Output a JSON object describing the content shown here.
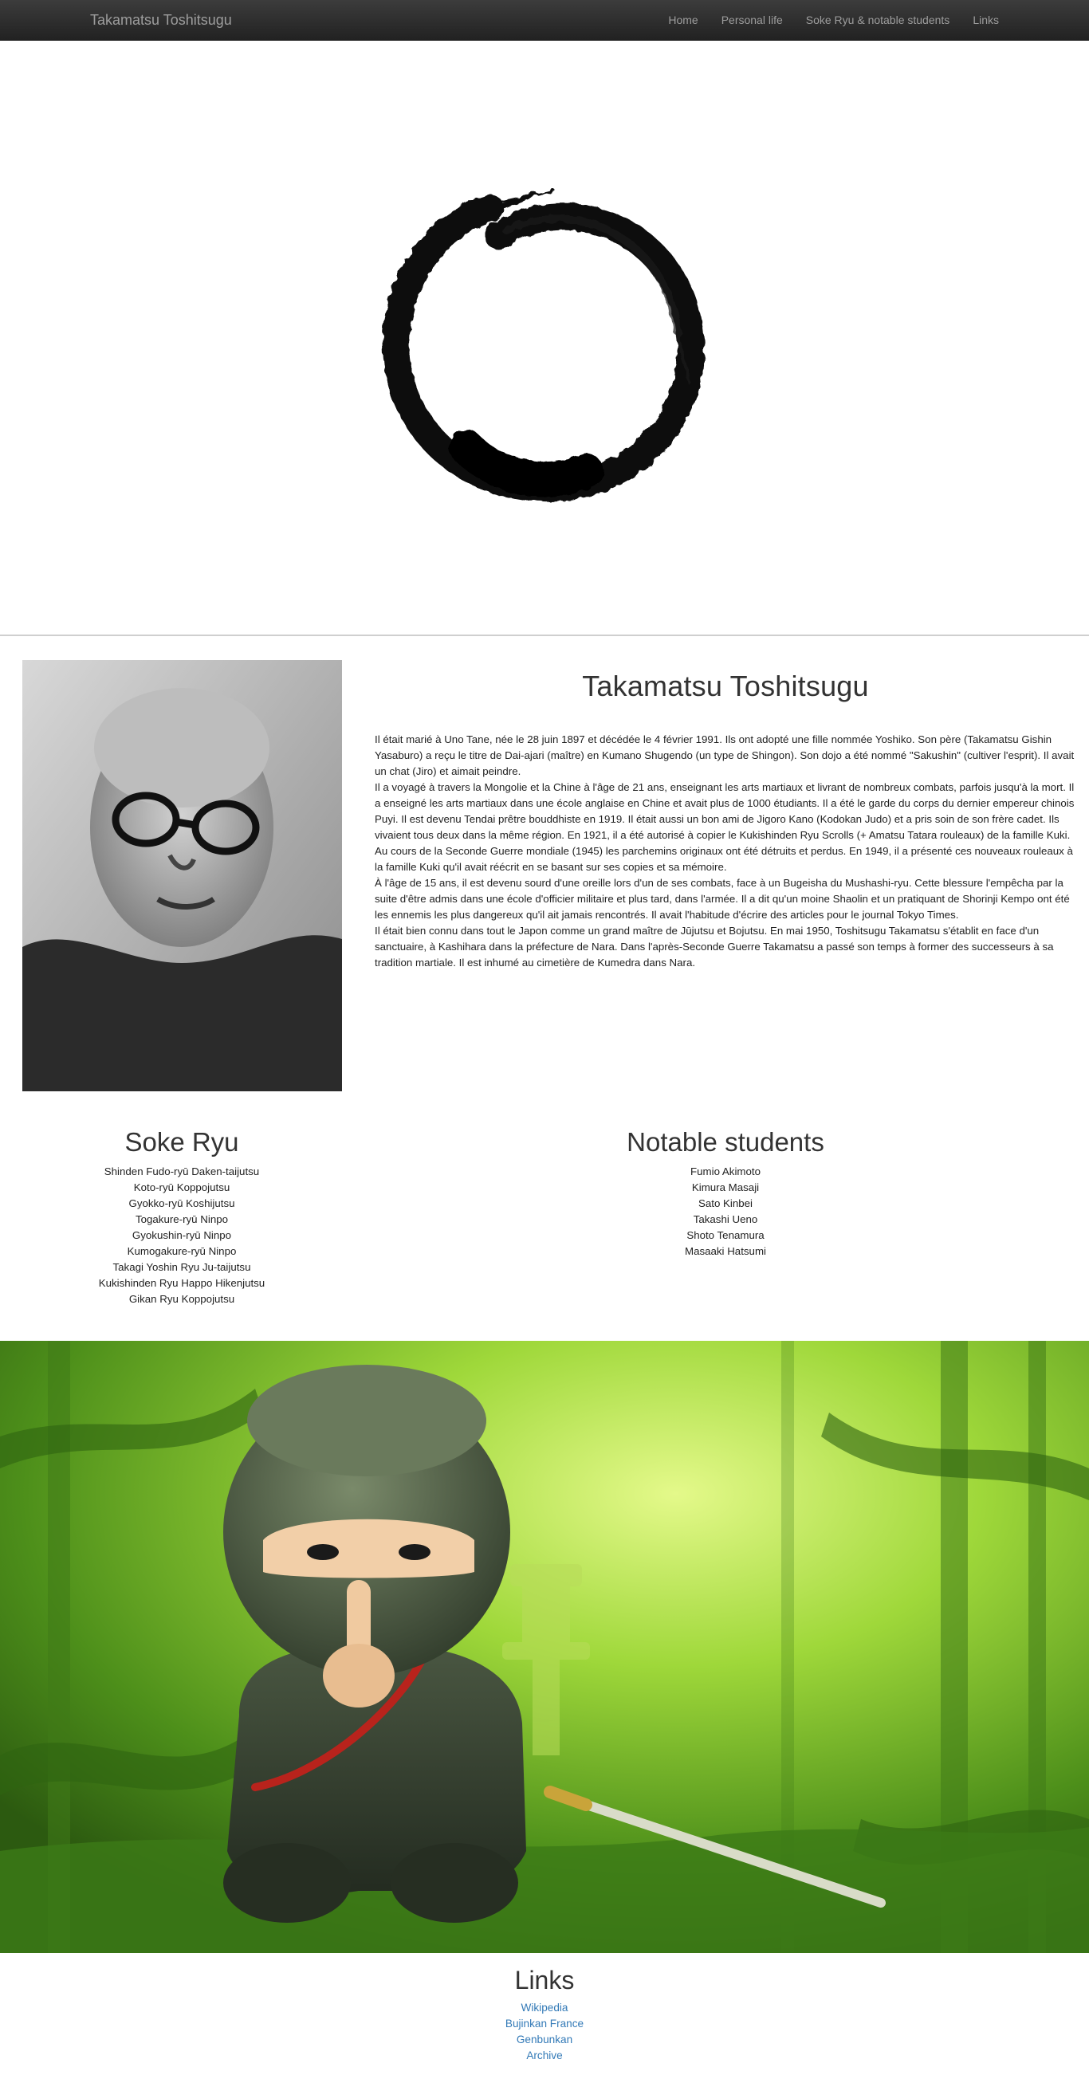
{
  "navbar": {
    "brand": "Takamatsu Toshitsugu",
    "links": [
      "Home",
      "Personal life",
      "Soke Ryu & notable students",
      "Links"
    ]
  },
  "hero": {
    "image": "enso-circle"
  },
  "bio": {
    "portrait": "portrait-photo",
    "title": "Takamatsu Toshitsugu",
    "paragraphs": [
      "Il était marié à Uno Tane, née le 28 juin 1897 et décédée le 4 février 1991. Ils ont adopté une fille nommée Yoshiko. Son père (Takamatsu Gishin Yasaburo) a reçu le titre de Dai-ajari (maître) en Kumano Shugendo (un type de Shingon). Son dojo a été nommé \"Sakushin\" (cultiver l'esprit). Il avait un chat (Jiro) et aimait peindre.",
      "Il a voyagé à travers la Mongolie et la Chine à l'âge de 21 ans, enseignant les arts martiaux et livrant de nombreux combats, parfois jusqu'à la mort. Il a enseigné les arts martiaux dans une école anglaise en Chine et avait plus de 1000 étudiants. Il a été le garde du corps du dernier empereur chinois Puyi. Il est devenu Tendai prêtre bouddhiste en 1919. Il était aussi un bon ami de Jigoro Kano (Kodokan Judo) et a pris soin de son frère cadet. Ils vivaient tous deux dans la même région. En 1921, il a été autorisé à copier le Kukishinden Ryu Scrolls (+ Amatsu Tatara rouleaux) de la famille Kuki. Au cours de la Seconde Guerre mondiale (1945) les parchemins originaux ont été détruits et perdus. En 1949, il a présenté ces nouveaux rouleaux à la famille Kuki qu'il avait réécrit en se basant sur ses copies et sa mémoire.",
      "À l'âge de 15 ans, il est devenu sourd d'une oreille lors d'un de ses combats, face à un Bugeisha du Mushashi-ryu. Cette blessure l'empêcha par la suite d'être admis dans une école d'officier militaire et plus tard, dans l'armée. Il a dit qu'un moine Shaolin et un pratiquant de Shorinji Kempo ont été les ennemis les plus dangereux qu'il ait jamais rencontrés. Il avait l'habitude d'écrire des articles pour le journal Tokyo Times.",
      "Il était bien connu dans tout le Japon comme un grand maître de Jūjutsu et Bojutsu. En mai 1950, Toshitsugu Takamatsu s'établit en face d'un sanctuaire, à Kashihara dans la préfecture de Nara. Dans l'après-Seconde Guerre Takamatsu a passé son temps à former des successeurs à sa tradition martiale. Il est inhumé au cimetière de Kumedra dans Nara."
    ]
  },
  "soke_ryu": {
    "heading": "Soke Ryu",
    "items": [
      "Shinden Fudo-ryū Daken-taijutsu",
      "Koto-ryū Koppojutsu",
      "Gyokko-ryū Koshijutsu",
      "Togakure-ryū Ninpo",
      "Gyokushin-ryū Ninpo",
      "Kumogakure-ryū Ninpo",
      "Takagi Yoshin Ryu Ju-taijutsu",
      "Kukishinden Ryu Happo Hikenjutsu",
      "Gikan Ryu Koppojutsu"
    ]
  },
  "students": {
    "heading": "Notable students",
    "items": [
      "Fumio Akimoto",
      "Kimura Masaji",
      "Sato Kinbei",
      "Takashi Ueno",
      "Shoto Tenamura",
      "Masaaki Hatsumi"
    ]
  },
  "banner": {
    "image": "ninja-illustration"
  },
  "links": {
    "heading": "Links",
    "items": [
      "Wikipedia",
      "Bujinkan France",
      "Genbunkan",
      "Archive"
    ]
  }
}
